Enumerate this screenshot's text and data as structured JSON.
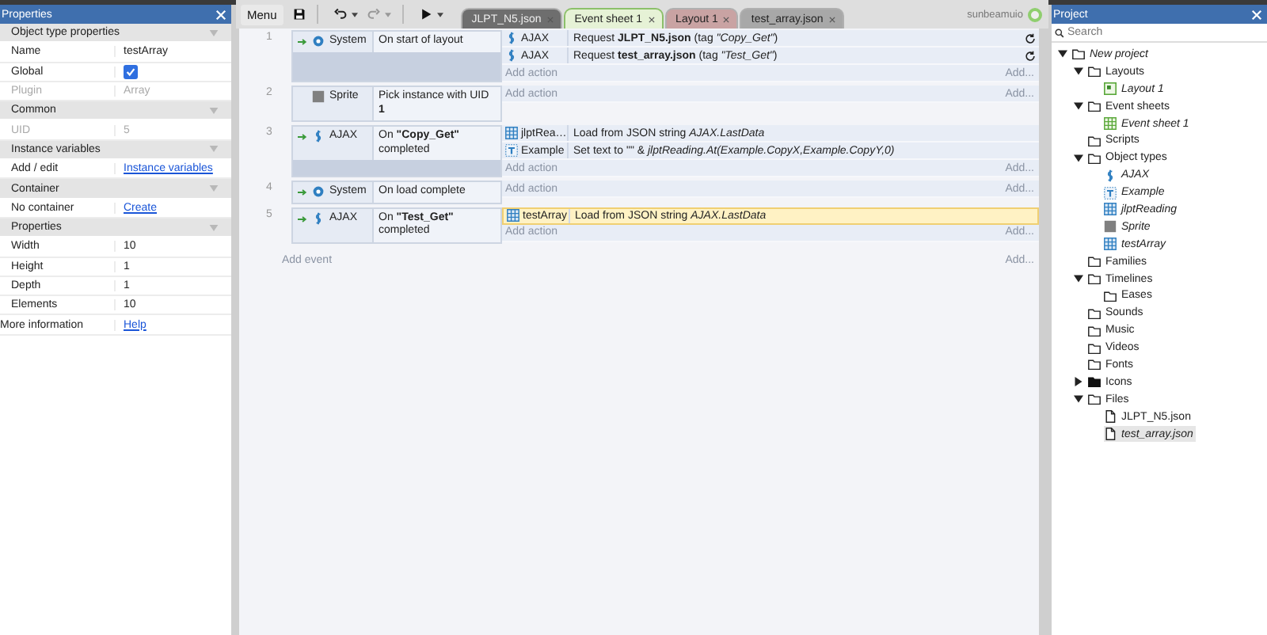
{
  "properties": {
    "title": "Properties",
    "sections": [
      {
        "title": "Object type properties",
        "rows": [
          {
            "label": "Name",
            "kind": "text",
            "value": "testArray",
            "disabled": false
          },
          {
            "label": "Global",
            "kind": "checkbox",
            "checked": true,
            "disabled": false
          },
          {
            "label": "Plugin",
            "kind": "text",
            "value": "Array",
            "disabled": true
          }
        ]
      },
      {
        "title": "Common",
        "rows": [
          {
            "label": "UID",
            "kind": "text",
            "value": "5",
            "disabled": true
          }
        ]
      },
      {
        "title": "Instance variables",
        "rows": [
          {
            "label": "Add / edit",
            "kind": "link",
            "value": "Instance variables",
            "disabled": false
          }
        ]
      },
      {
        "title": "Container",
        "rows": [
          {
            "label": "No container",
            "kind": "link",
            "value": "Create",
            "disabled": false
          }
        ]
      },
      {
        "title": "Properties",
        "rows": [
          {
            "label": "Width",
            "kind": "text",
            "value": "10",
            "disabled": false
          },
          {
            "label": "Height",
            "kind": "text",
            "value": "1",
            "disabled": false
          },
          {
            "label": "Depth",
            "kind": "text",
            "value": "1",
            "disabled": false
          },
          {
            "label": "Elements",
            "kind": "text",
            "value": "10",
            "disabled": false
          }
        ]
      }
    ],
    "footer": {
      "label": "More information",
      "link": "Help"
    }
  },
  "toolbar": {
    "menu": "Menu",
    "tabs": [
      {
        "label": "JLPT_N5.json",
        "selected": false,
        "color": "#6e6e6e"
      },
      {
        "label": "Event sheet 1",
        "selected": true,
        "color": "#e6f2d6"
      },
      {
        "label": "Layout 1",
        "selected": false,
        "color": "#c9a3a3"
      },
      {
        "label": "test_array.json",
        "selected": false,
        "color": "#a8a8a8"
      }
    ],
    "user": "sunbeamuio"
  },
  "events": [
    {
      "number": "1",
      "trigger": true,
      "object": {
        "name": "System",
        "kind": "system"
      },
      "condition": "On start of layout",
      "actions": [
        {
          "object": "AJAX",
          "kind": "ajax",
          "text": "Request **JLPT_N5.json** (tag *\"Copy_Get\"*)",
          "selected": false,
          "refresh": true
        },
        {
          "object": "AJAX",
          "kind": "ajax",
          "text": "Request **test_array.json** (tag *\"Test_Get\"*)",
          "selected": false,
          "refresh": true
        }
      ],
      "add_action": "Add action",
      "add_more": "Add..."
    },
    {
      "number": "2",
      "trigger": false,
      "object": {
        "name": "Sprite",
        "kind": "sprite"
      },
      "condition": "Pick instance with UID **1**",
      "add_action": "Add action",
      "add_more": "Add..."
    },
    {
      "number": "3",
      "trigger": true,
      "object": {
        "name": "AJAX",
        "kind": "ajax"
      },
      "condition": "On **\"Copy_Get\"** completed",
      "actions": [
        {
          "object": "jlptRea…",
          "kind": "array",
          "text": "Load from JSON string *AJAX.LastData*",
          "selected": false,
          "refresh": false
        },
        {
          "object": "Example",
          "kind": "text",
          "text": "Set text to \"\" & *jlptReading.At(Example.CopyX,Example.CopyY,0)*",
          "selected": false,
          "refresh": false
        }
      ],
      "add_action": "Add action",
      "add_more": "Add..."
    },
    {
      "number": "4",
      "trigger": true,
      "object": {
        "name": "System",
        "kind": "system"
      },
      "condition": "On load complete",
      "add_action": "Add action",
      "add_more": "Add..."
    },
    {
      "number": "5",
      "trigger": true,
      "object": {
        "name": "AJAX",
        "kind": "ajax"
      },
      "condition": "On **\"Test_Get\"** completed",
      "actions": [
        {
          "object": "testArray",
          "kind": "array",
          "text": "Load from JSON string *AJAX.LastData*",
          "selected": true,
          "refresh": false
        }
      ],
      "add_action": "Add action",
      "add_more": "Add..."
    }
  ],
  "add_event": "Add event",
  "add_event_more": "Add...",
  "project": {
    "title": "Project",
    "search_placeholder": "Search",
    "tree": [
      {
        "label": "New project",
        "kind": "folder",
        "italic": true,
        "selected": false,
        "expanded": true,
        "children": [
          {
            "label": "Layouts",
            "kind": "folder",
            "italic": false,
            "selected": false,
            "expanded": true,
            "children": [
              {
                "label": "Layout 1",
                "kind": "layout",
                "italic": true,
                "selected": false
              }
            ]
          },
          {
            "label": "Event sheets",
            "kind": "folder",
            "italic": false,
            "selected": false,
            "expanded": true,
            "children": [
              {
                "label": "Event sheet 1",
                "kind": "sheet",
                "italic": true,
                "selected": false
              }
            ]
          },
          {
            "label": "Scripts",
            "kind": "folder",
            "italic": false,
            "selected": false
          },
          {
            "label": "Object types",
            "kind": "folder",
            "italic": false,
            "selected": false,
            "expanded": true,
            "children": [
              {
                "label": "AJAX",
                "kind": "ajax",
                "italic": true,
                "selected": false
              },
              {
                "label": "Example",
                "kind": "text",
                "italic": true,
                "selected": false
              },
              {
                "label": "jlptReading",
                "kind": "array",
                "italic": true,
                "selected": false
              },
              {
                "label": "Sprite",
                "kind": "sprite",
                "italic": true,
                "selected": false
              },
              {
                "label": "testArray",
                "kind": "array",
                "italic": true,
                "selected": false
              }
            ]
          },
          {
            "label": "Families",
            "kind": "folder",
            "italic": false,
            "selected": false
          },
          {
            "label": "Timelines",
            "kind": "folder",
            "italic": false,
            "selected": false,
            "expanded": true,
            "children": [
              {
                "label": "Eases",
                "kind": "folder",
                "italic": false,
                "selected": false
              }
            ]
          },
          {
            "label": "Sounds",
            "kind": "folder",
            "italic": false,
            "selected": false
          },
          {
            "label": "Music",
            "kind": "folder",
            "italic": false,
            "selected": false
          },
          {
            "label": "Videos",
            "kind": "folder",
            "italic": false,
            "selected": false
          },
          {
            "label": "Fonts",
            "kind": "folder",
            "italic": false,
            "selected": false
          },
          {
            "label": "Icons",
            "kind": "folder-filled",
            "italic": false,
            "selected": false,
            "expanded": false
          },
          {
            "label": "Files",
            "kind": "folder",
            "italic": false,
            "selected": false,
            "expanded": true,
            "children": [
              {
                "label": "JLPT_N5.json",
                "kind": "file",
                "italic": false,
                "selected": false
              },
              {
                "label": "test_array.json",
                "kind": "file",
                "italic": true,
                "selected": true
              }
            ]
          }
        ]
      }
    ]
  }
}
